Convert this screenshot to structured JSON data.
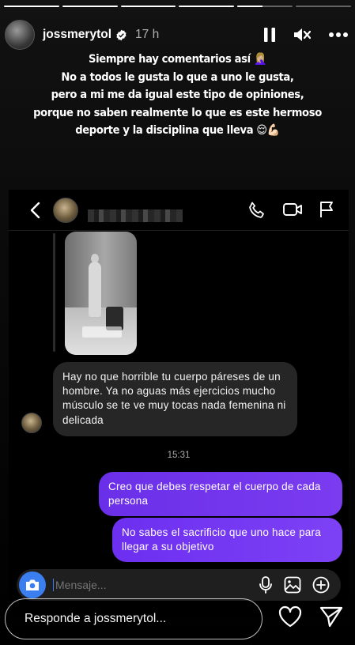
{
  "story": {
    "progress": [
      1,
      1,
      1,
      1,
      0.45,
      0
    ],
    "username": "jossmerytol",
    "time_ago": "17 h"
  },
  "caption": {
    "lines": [
      "Siempre hay comentarios así 🤦🏼‍♀️",
      "No a todos le gusta lo que a uno le gusta,",
      "pero a mi me da igual este tipo de opiniones,",
      "porque no saben realmente lo que es este hermoso",
      "deporte y la disciplina que lleva 😌💪🏻"
    ]
  },
  "chat": {
    "incoming_message": "Hay no que horrible tu cuerpo páreses de un hombre. Ya no aguas más ejercicios mucho músculo se te ve muy tocas nada femenina ni delicada",
    "timestamp": "15:31",
    "outgoing_messages": [
      "Creo que debes respetar el cuerpo de cada persona",
      "No sabes el sacrificio que uno hace para llegar a su objetivo"
    ],
    "composer_placeholder": "Mensaje..."
  },
  "reply": {
    "placeholder": "Responde a jossmerytol..."
  },
  "colors": {
    "outgoing_bubble": "#7436ee",
    "incoming_bubble": "#262626",
    "camera_button": "#3a7ef0"
  },
  "icons": [
    "pause-icon",
    "mute-icon",
    "more-icon",
    "back-icon",
    "phone-icon",
    "video-icon",
    "flag-icon",
    "camera-icon",
    "mic-icon",
    "gallery-icon",
    "add-icon",
    "heart-icon",
    "send-icon",
    "verified-icon"
  ]
}
